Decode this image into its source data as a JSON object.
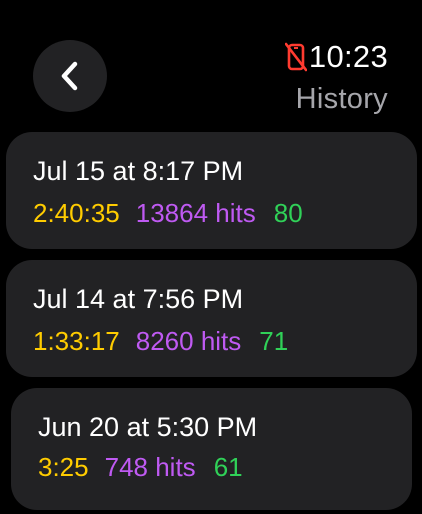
{
  "header": {
    "time": "10:23",
    "title": "History",
    "status_icon": "phone-disconnected-icon",
    "status_icon_color": "#ff3b30"
  },
  "back_button": {
    "icon": "chevron-left-icon"
  },
  "colors": {
    "duration": "#ffcc00",
    "hits": "#bf5af2",
    "score": "#30d158",
    "card_background": "#222224",
    "title_gray": "#a6a6ab"
  },
  "sessions": [
    {
      "date": "Jul 15 at 8:17 PM",
      "duration": "2:40:35",
      "hits": "13864 hits",
      "score": "80"
    },
    {
      "date": "Jul 14 at 7:56 PM",
      "duration": "1:33:17",
      "hits": "8260 hits",
      "score": "71"
    },
    {
      "date": "Jun 20 at 5:30 PM",
      "duration": "3:25",
      "hits": "748 hits",
      "score": "61"
    }
  ]
}
